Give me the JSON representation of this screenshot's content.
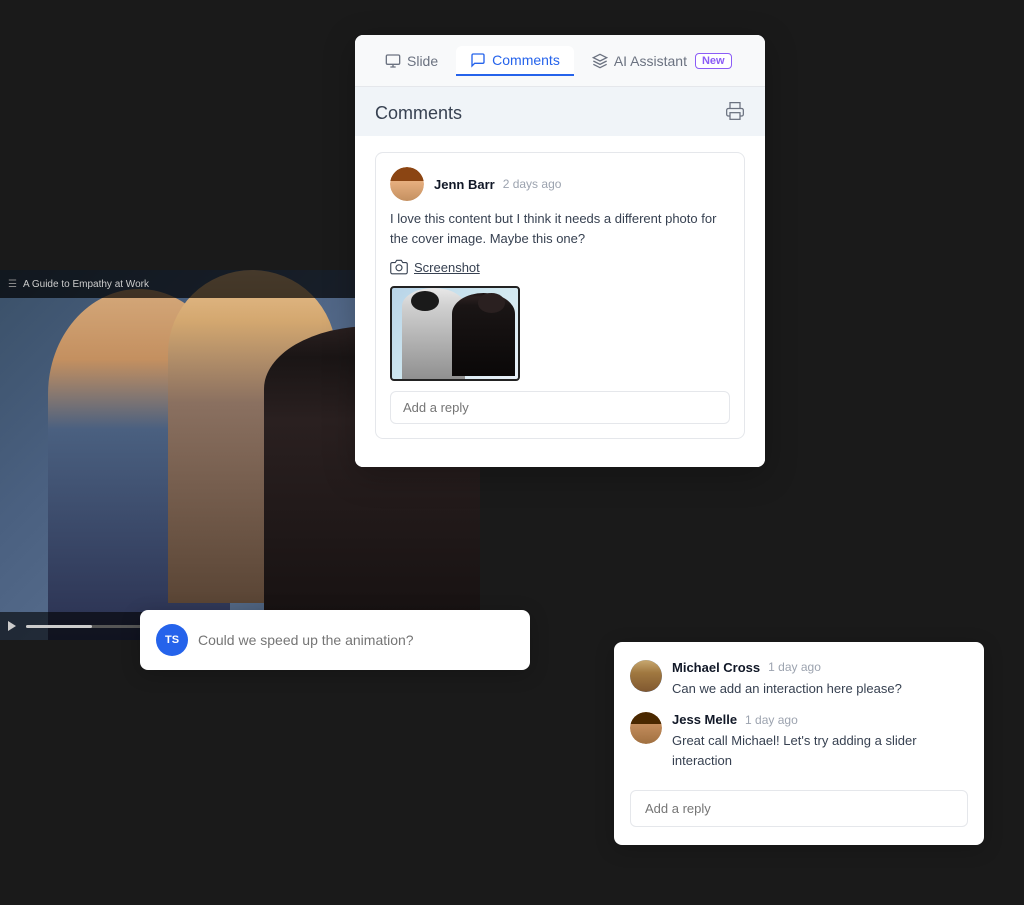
{
  "app": {
    "background": "#1a1a1a"
  },
  "slide": {
    "title": "A Guide to Empathy at Work"
  },
  "tabs": {
    "slide_label": "Slide",
    "comments_label": "Comments",
    "ai_assistant_label": "AI Assistant",
    "new_badge": "New",
    "active": "comments"
  },
  "comments_panel": {
    "title": "Comments",
    "comment1": {
      "author": "Jenn Barr",
      "time": "2 days ago",
      "text": "I love this content but I think it needs a different photo for the cover image. Maybe this one?",
      "screenshot_label": "Screenshot",
      "reply_placeholder": "Add a reply"
    }
  },
  "floating_input": {
    "avatar_initials": "TS",
    "placeholder": "Could we speed up the animation?"
  },
  "comment_thread": {
    "comment1": {
      "author": "Michael Cross",
      "time": "1 day ago",
      "text": "Can we add an interaction here please?"
    },
    "comment2": {
      "author": "Jess Melle",
      "time": "1 day ago",
      "text": "Great call Michael! Let's try adding a slider interaction"
    },
    "reply_placeholder": "Add a reply"
  }
}
